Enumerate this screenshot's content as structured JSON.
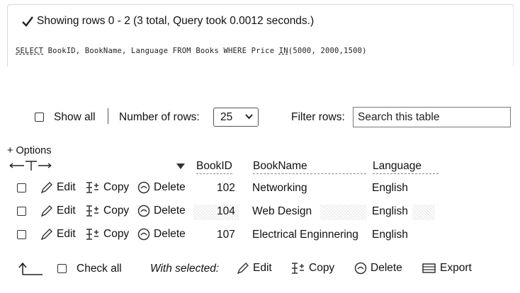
{
  "message": {
    "text": "Showing rows 0 - 2 (3 total, Query took 0.0012 seconds.)",
    "query_keyword_select": "SELECT",
    "query_mid": " BookID, BookName, Language FROM Books WHERE Price ",
    "query_keyword_in": "IN",
    "query_end": "(5000, 2000,1500)"
  },
  "controls": {
    "show_all_label": "Show all",
    "number_of_rows_label": "Number of rows:",
    "number_of_rows_value": "25",
    "filter_rows_label": "Filter rows:",
    "search_placeholder": "Search this table"
  },
  "table": {
    "options_label": "+ Options",
    "columns": [
      "BookID",
      "BookName",
      "Language"
    ],
    "actions": {
      "edit": "Edit",
      "copy": "Copy",
      "delete": "Delete"
    },
    "rows": [
      {
        "id": "102",
        "name": "Networking",
        "language": "English"
      },
      {
        "id": "104",
        "name": "Web Design",
        "language": "English"
      },
      {
        "id": "107",
        "name": "Electrical Enginnering",
        "language": "English"
      }
    ]
  },
  "footer": {
    "check_all_label": "Check all",
    "with_selected_label": "With selected:",
    "edit_label": "Edit",
    "copy_label": "Copy",
    "delete_label": "Delete",
    "export_label": "Export"
  },
  "icons": {
    "check": "check-icon",
    "pencil": "pencil-icon",
    "copy": "copy-icon",
    "delete": "delete-icon",
    "export": "export-icon",
    "sort": "sort-desc-icon",
    "arrow_up": "arrow-up-icon"
  }
}
